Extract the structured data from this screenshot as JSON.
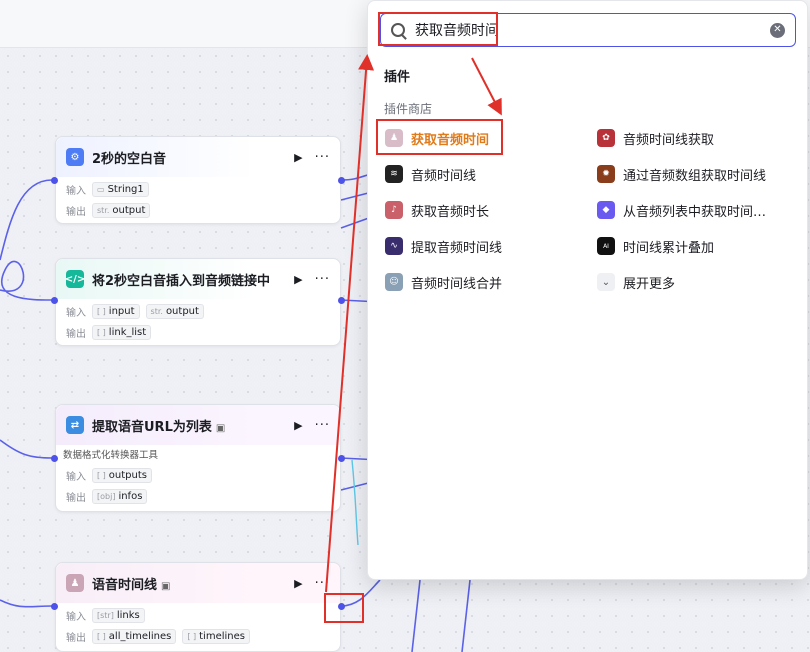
{
  "nodes": [
    {
      "title": "2秒的空白音",
      "input_label": "输入",
      "output_label": "输出",
      "inputs": [
        {
          "type": "",
          "name": "String1"
        }
      ],
      "outputs": [
        {
          "type": "str.",
          "name": "output"
        }
      ]
    },
    {
      "title": "将2秒空白音插入到音频链接中",
      "input_label": "输入",
      "output_label": "输出",
      "inputs": [
        {
          "type": "[ ]",
          "name": "input"
        },
        {
          "type": "str.",
          "name": "output"
        }
      ],
      "outputs": [
        {
          "type": "[ ]",
          "name": "link_list"
        }
      ]
    },
    {
      "title": "提取语音URL为列表",
      "description": "数据格式化转换器工具",
      "input_label": "输入",
      "output_label": "输出",
      "inputs": [
        {
          "type": "[ ]",
          "name": "outputs"
        }
      ],
      "outputs": [
        {
          "type": "[obj]",
          "name": "infos"
        }
      ]
    },
    {
      "title": "语音时间线",
      "input_label": "输入",
      "output_label": "输出",
      "inputs": [
        {
          "type": "[str]",
          "name": "links"
        }
      ],
      "outputs": [
        {
          "type": "[ ]",
          "name": "all_timelines"
        },
        {
          "type": "[ ]",
          "name": "timelines"
        }
      ]
    }
  ],
  "node_actions": {
    "run": "▶",
    "more": "···"
  },
  "search": {
    "value": "获取音频时间"
  },
  "popup": {
    "section": "插件",
    "subsection": "插件商店",
    "results_left": [
      "获取音频时间",
      "音频时间线",
      "获取音频时长",
      "提取音频时间线",
      "音频时间线合并"
    ],
    "results_right": [
      "音频时间线获取",
      "通过音频数组获取时间线",
      "从音频列表中获取时间…",
      "时间线累计叠加"
    ],
    "expand_more": "展开更多"
  },
  "colors": {
    "accent": "#4d53e8",
    "highlight": "#e07b1b",
    "annotation": "#e0302a"
  }
}
